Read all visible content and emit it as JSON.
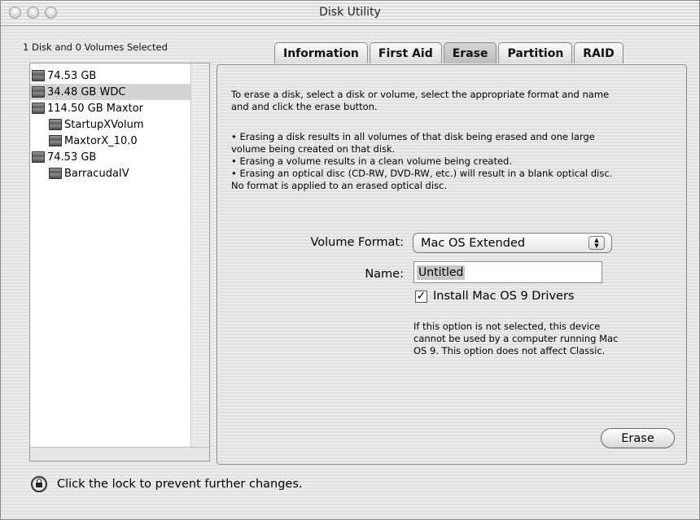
{
  "window": {
    "title": "Disk Utility"
  },
  "selection_status": "1 Disk and 0 Volumes Selected",
  "sidebar": {
    "items": [
      {
        "label": "74.53 GB",
        "level": 0,
        "selected": false
      },
      {
        "label": "34.48 GB WDC",
        "level": 0,
        "selected": true
      },
      {
        "label": "114.50 GB Maxtor",
        "level": 0,
        "selected": false
      },
      {
        "label": "StartupXVolum",
        "level": 1,
        "selected": false
      },
      {
        "label": "MaxtorX_10.0",
        "level": 1,
        "selected": false
      },
      {
        "label": "74.53 GB",
        "level": 0,
        "selected": false
      },
      {
        "label": "BarracudaIV",
        "level": 1,
        "selected": false
      }
    ]
  },
  "tabs": [
    {
      "label": "Information",
      "active": false
    },
    {
      "label": "First Aid",
      "active": false
    },
    {
      "label": "Erase",
      "active": true
    },
    {
      "label": "Partition",
      "active": false
    },
    {
      "label": "RAID",
      "active": false
    }
  ],
  "erase_panel": {
    "intro_line1": "To erase a disk, select a disk or volume, select the appropriate format and name",
    "intro_line2": "and and click the erase button.",
    "bullet1_line1": "• Erasing a disk results in all volumes of that disk being erased and one large",
    "bullet1_line2": "volume being created on that disk.",
    "bullet2": "• Erasing a volume results in a clean volume being created.",
    "bullet3_line1": "• Erasing an optical disc (CD-RW, DVD-RW, etc.) will result in a blank optical disc.",
    "bullet3_line2": "No format is applied to an erased optical disc.",
    "volume_format_label": "Volume Format:",
    "volume_format_value": "Mac OS Extended",
    "name_label": "Name:",
    "name_value": "Untitled",
    "checkbox_label": "Install Mac OS 9 Drivers",
    "checkbox_checked": true,
    "note_line1": "If this option is not selected, this device",
    "note_line2": "cannot be used by a computer running Mac",
    "note_line3": "OS 9.  This option does not affect Classic.",
    "erase_button": "Erase"
  },
  "footer": {
    "lock_text": "Click the lock to prevent further changes."
  }
}
